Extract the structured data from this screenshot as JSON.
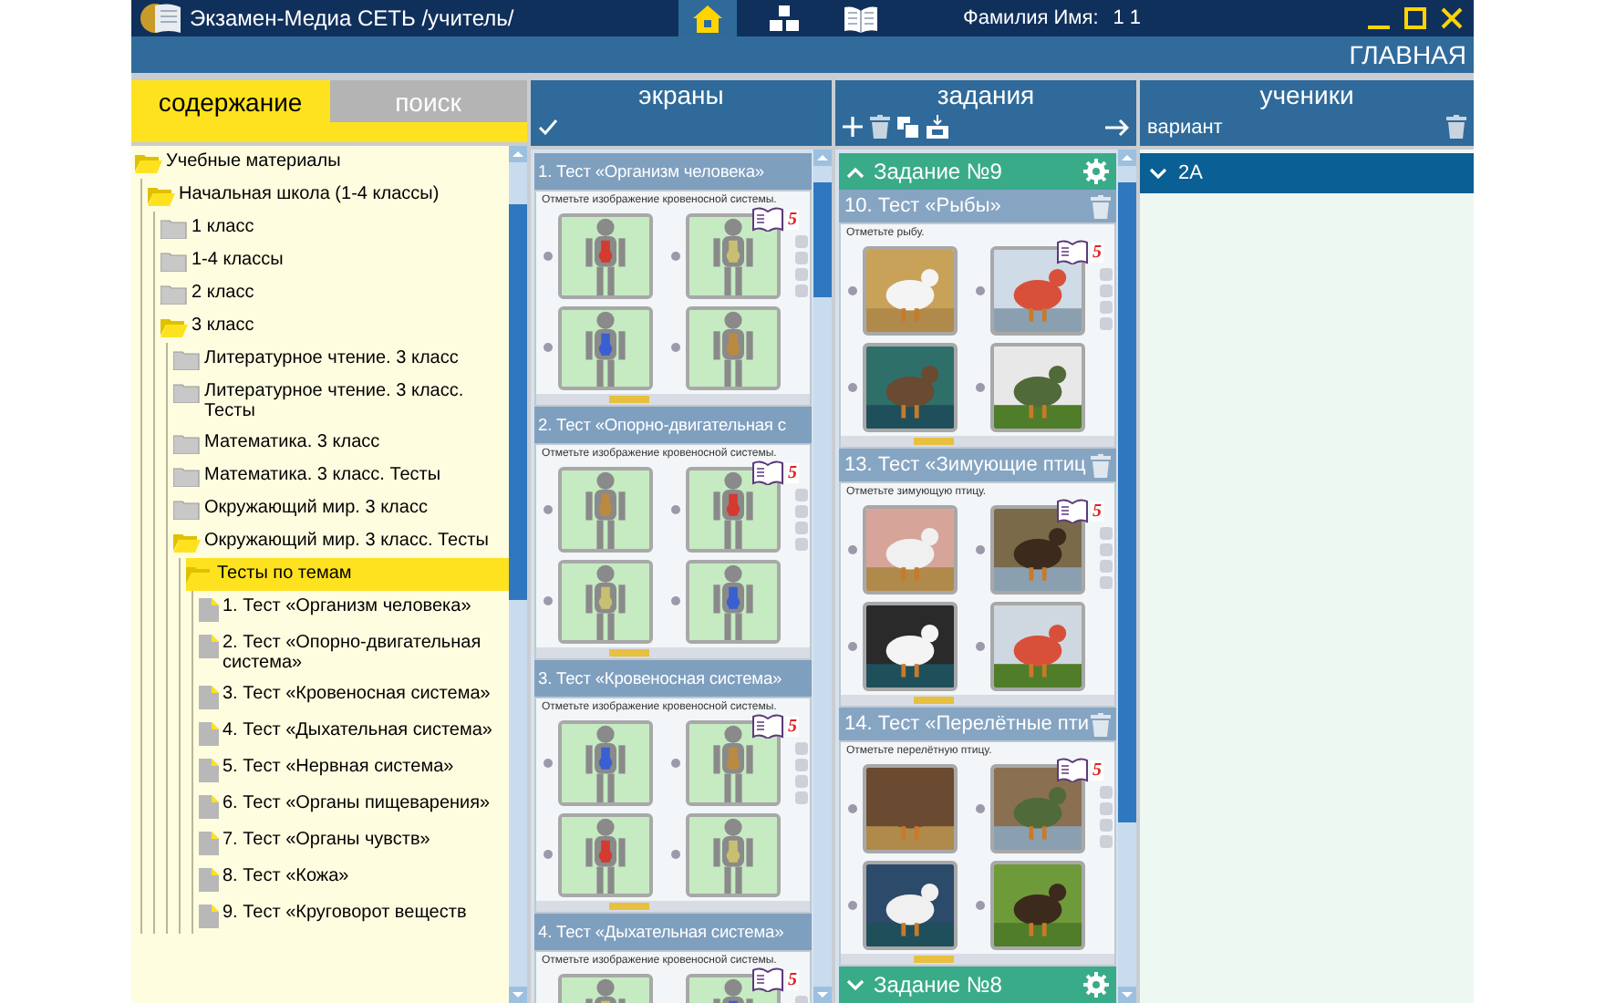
{
  "window": {
    "title": "Экзамен-Медиа СЕТЬ /учитель/",
    "page_title": "ГЛАВНАЯ",
    "user_label": "Фамилия Имя:",
    "user_value": "1 1"
  },
  "nav_tabs": [
    {
      "kind": "home",
      "selected": true
    },
    {
      "kind": "structure",
      "selected": false
    },
    {
      "kind": "book",
      "selected": false
    }
  ],
  "left_tabs": [
    {
      "label": "содержание",
      "selected": true
    },
    {
      "label": "поиск",
      "selected": false
    }
  ],
  "tree": [
    {
      "label": "Учебные материалы",
      "kind": "folder",
      "expanded": true,
      "selected": false,
      "children": [
        {
          "label": "Начальная школа (1-4 классы)",
          "kind": "folder",
          "expanded": true,
          "selected": false,
          "children": [
            {
              "label": "1 класс",
              "kind": "folder",
              "expanded": false,
              "selected": false
            },
            {
              "label": "1-4 классы",
              "kind": "folder",
              "expanded": false,
              "selected": false
            },
            {
              "label": "2 класс",
              "kind": "folder",
              "expanded": false,
              "selected": false
            },
            {
              "label": "3 класс",
              "kind": "folder",
              "expanded": true,
              "selected": false,
              "children": [
                {
                  "label": "Литературное чтение. 3 класс",
                  "kind": "folder",
                  "expanded": false,
                  "selected": false
                },
                {
                  "label": "Литературное чтение. 3 класс. Тесты",
                  "kind": "folder",
                  "expanded": false,
                  "selected": false
                },
                {
                  "label": "Математика. 3 класс",
                  "kind": "folder",
                  "expanded": false,
                  "selected": false
                },
                {
                  "label": "Математика. 3 класс. Тесты",
                  "kind": "folder",
                  "expanded": false,
                  "selected": false
                },
                {
                  "label": "Окружающий мир. 3 класс",
                  "kind": "folder",
                  "expanded": false,
                  "selected": false
                },
                {
                  "label": "Окружающий мир. 3 класс. Тесты",
                  "kind": "folder",
                  "expanded": true,
                  "selected": false,
                  "children": [
                    {
                      "label": "Тесты по темам",
                      "kind": "folder",
                      "expanded": true,
                      "selected": true,
                      "children": [
                        {
                          "label": "1. Тест «Организм человека»",
                          "kind": "file",
                          "selected": false
                        },
                        {
                          "label": "2. Тест «Опорно-двигательная система»",
                          "kind": "file",
                          "selected": false
                        },
                        {
                          "label": "3. Тест «Кровеносная система»",
                          "kind": "file",
                          "selected": false
                        },
                        {
                          "label": "4. Тест «Дыхательная система»",
                          "kind": "file",
                          "selected": false
                        },
                        {
                          "label": "5. Тест «Нервная система»",
                          "kind": "file",
                          "selected": false
                        },
                        {
                          "label": "6. Тест «Органы пищеварения»",
                          "kind": "file",
                          "selected": false
                        },
                        {
                          "label": "7. Тест «Органы чувств»",
                          "kind": "file",
                          "selected": false
                        },
                        {
                          "label": "8. Тест «Кожа»",
                          "kind": "file",
                          "selected": false
                        },
                        {
                          "label": "9. Тест «Круговорот веществ",
                          "kind": "file",
                          "selected": false
                        }
                      ]
                    }
                  ]
                }
              ]
            }
          ]
        }
      ]
    }
  ],
  "screens": {
    "title": "экраны",
    "items": [
      {
        "title": "1. Тест «Организм человека»",
        "question": "Отметьте изображение кровеносной системы.",
        "grade": "5",
        "options": [
          {
            "selected": false
          },
          {
            "selected": false
          },
          {
            "selected": false
          },
          {
            "selected": false
          }
        ]
      },
      {
        "title": "2. Тест «Опорно-двигательная с",
        "question": "Отметьте изображение кровеносной системы.",
        "grade": "5",
        "options": [
          {
            "selected": false
          },
          {
            "selected": false
          },
          {
            "selected": false
          },
          {
            "selected": false
          }
        ]
      },
      {
        "title": "3. Тест «Кровеносная система»",
        "question": "Отметьте изображение кровеносной системы.",
        "grade": "5",
        "options": [
          {
            "selected": false
          },
          {
            "selected": false
          },
          {
            "selected": false
          },
          {
            "selected": false
          }
        ]
      },
      {
        "title": "4. Тест «Дыхательная система»",
        "question": "Отметьте изображение кровеносной системы.",
        "grade": "5"
      }
    ]
  },
  "tasks": {
    "title": "задания",
    "groups": [
      {
        "title": "Задание №9",
        "expanded": true,
        "items": [
          {
            "title": "10. Тест «Рыбы»",
            "question": "Отметьте рыбу.",
            "grade": "5",
            "options": [
              {
                "selected": false
              },
              {
                "selected": false
              },
              {
                "selected": false
              },
              {
                "selected": false
              }
            ]
          },
          {
            "title": "13. Тест «Зимующие птиц",
            "question": "Отметьте зимующую птицу.",
            "grade": "5",
            "options": [
              {
                "selected": false
              },
              {
                "selected": false
              },
              {
                "selected": false
              },
              {
                "selected": false
              }
            ]
          },
          {
            "title": "14. Тест «Перелётные пти",
            "question": "Отметьте перелётную птицу.",
            "grade": "5",
            "options": [
              {
                "selected": false
              },
              {
                "selected": false
              },
              {
                "selected": false
              },
              {
                "selected": false
              }
            ]
          }
        ]
      },
      {
        "title": "Задание №8",
        "expanded": false
      }
    ]
  },
  "students": {
    "title": "ученики",
    "variant_label": "вариант",
    "classes": [
      {
        "name": "2А",
        "expanded": false
      }
    ]
  }
}
